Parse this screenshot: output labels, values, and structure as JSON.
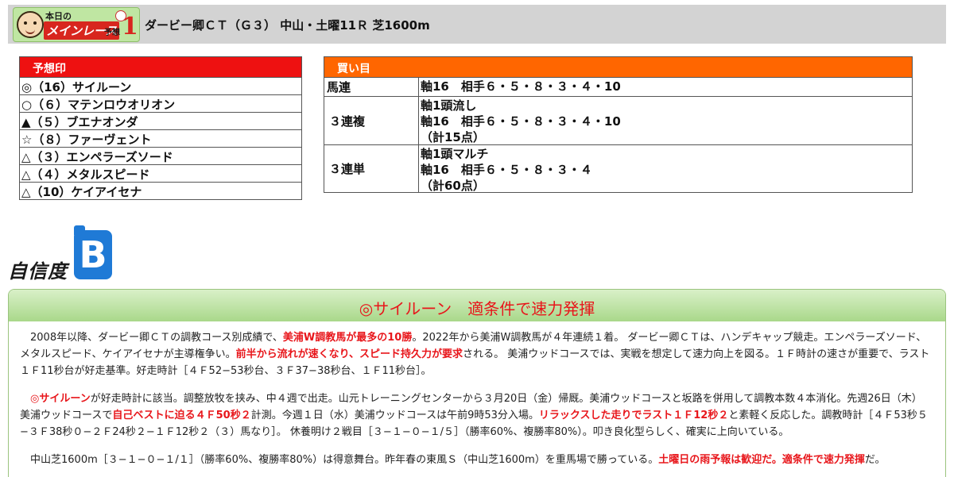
{
  "header": {
    "logo": {
      "small_text": "本日の",
      "main_text": "メインレース",
      "yoso_text": "予想",
      "number": "1"
    },
    "title": "ダービー卿ＣＴ（Ｇ３） 中山・土曜11Ｒ 芝1600m"
  },
  "marks": {
    "heading": "予想印",
    "rows": [
      "◎（16）サイルーン",
      "○（６）マテンロウオリオン",
      "▲（５）ブエナオンダ",
      "☆（８）ファーヴェント",
      "△（３）エンペラーズソード",
      "△（４）メタルスピード",
      "△（10）ケイアイセナ"
    ]
  },
  "bets": {
    "heading": "買い目",
    "rows": [
      {
        "type": "馬連",
        "lines": [
          "軸16　相手６・５・８・３・４・10"
        ]
      },
      {
        "type": "３連複",
        "lines": [
          "軸1頭流し",
          "軸16　相手６・５・８・３・４・10",
          "（計15点）"
        ]
      },
      {
        "type": "３連単",
        "lines": [
          "軸1頭マルチ",
          "軸16　相手６・５・８・３・４",
          "（計60点）"
        ]
      }
    ]
  },
  "confidence": {
    "label": "自信度",
    "grade": "B",
    "badge_color": "#1f7ad6"
  },
  "analysis": {
    "heading": "◎サイルーン　適条件で速力発揮",
    "p1": {
      "a": "　2008年以降、ダービー卿ＣＴの調教コース別成績で、",
      "b": "美浦W調教馬が最多の10勝",
      "c": "。2022年から美浦W調教馬が４年連続１着。 ダービー卿ＣＴは、ハンデキャップ競走。エンペラーズソード、メタルスピード、ケイアイセナが主導権争い。",
      "d": "前半から流れが速くなり、スピード持久力が要求",
      "e": "される。 美浦ウッドコースでは、実戦を想定して速力向上を図る。１Ｆ時計の速さが重要で、ラスト１Ｆ11秒台が好走基準。好走時計［４Ｆ52−53秒台、３Ｆ37−38秒台、１Ｆ11秒台］。"
    },
    "p2": {
      "a": "◎サイルーン",
      "b": "が好走時計に該当。調整放牧を挟み、中４週で出走。山元トレーニングセンターから３月20日（金）帰厩。美浦ウッドコースと坂路を併用して調教本数４本消化。先週26日（木）美浦ウッドコースで",
      "c": "自己ベストに迫る４Ｆ50秒２",
      "d": "計測。今週１日（水）美浦ウッドコースは午前9時53分入場。",
      "e": "リラックスした走りでラスト１Ｆ12秒２",
      "f": "と素軽く反応した。調教時計［４Ｆ53秒５−３Ｆ38秒０−２Ｆ24秒２−１Ｆ12秒２（３）馬なり］。 休養明け２戦目［３−１−０−１/５］（勝率60%、複勝率80%）。叩き良化型らしく、確実に上向いている。"
    },
    "p3": {
      "a": "　中山芝1600m［３−１−０−１/１］（勝率60%、複勝率80%）は得意舞台。昨年春の東風Ｓ（中山芝1600m）を重馬場で勝っている。",
      "b": "土曜日の雨予報は歓迎だ。適条件で速力発揮",
      "c": "だ。"
    }
  }
}
